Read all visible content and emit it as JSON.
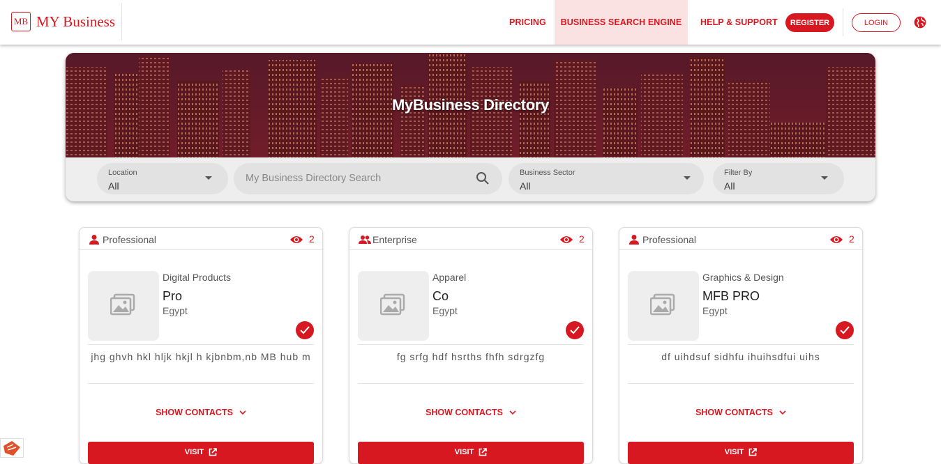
{
  "header": {
    "logo_mark": "MB",
    "logo_text": "MY Business",
    "nav": {
      "pricing": "PRICING",
      "business_search_engine": "BUSINESS SEARCH ENGINE",
      "help_support": "HELP & SUPPORT",
      "register": "REGISTER",
      "login": "LOGIN"
    },
    "language_icon": "globe-icon",
    "accent_color": "#d81820"
  },
  "hero": {
    "title": "MyBusiness Directory",
    "filters": {
      "location": {
        "label": "Location",
        "value": "All"
      },
      "search": {
        "placeholder": "My Business Directory Search"
      },
      "sector": {
        "label": "Business Sector",
        "value": "All"
      },
      "filter_by": {
        "label": "Filter By",
        "value": "All"
      }
    }
  },
  "cards": [
    {
      "tier": "Professional",
      "tier_icon": "person-icon",
      "views": "2",
      "sector": "Digital Products",
      "name": "Pro",
      "country": "Egypt",
      "verified": true,
      "description": "jhg ghvh hkl hljk hkjl h kjbnbm,nb MB hub m",
      "show_contacts": "SHOW CONTACTS",
      "visit": "VISIT"
    },
    {
      "tier": "Enterprise",
      "tier_icon": "group-icon",
      "views": "2",
      "sector": "Apparel",
      "name": "Co",
      "country": "Egypt",
      "verified": true,
      "description": "fg srfg hdf hsrths fhfh sdrgzfg",
      "show_contacts": "SHOW CONTACTS",
      "visit": "VISIT"
    },
    {
      "tier": "Professional",
      "tier_icon": "person-icon",
      "views": "2",
      "sector": "Graphics & Design",
      "name": "MFB PRO",
      "country": "Egypt",
      "verified": true,
      "description": "df uihdsuf sidhfu ihuihsdfui uihs",
      "show_contacts": "SHOW CONTACTS",
      "visit": "VISIT"
    }
  ]
}
